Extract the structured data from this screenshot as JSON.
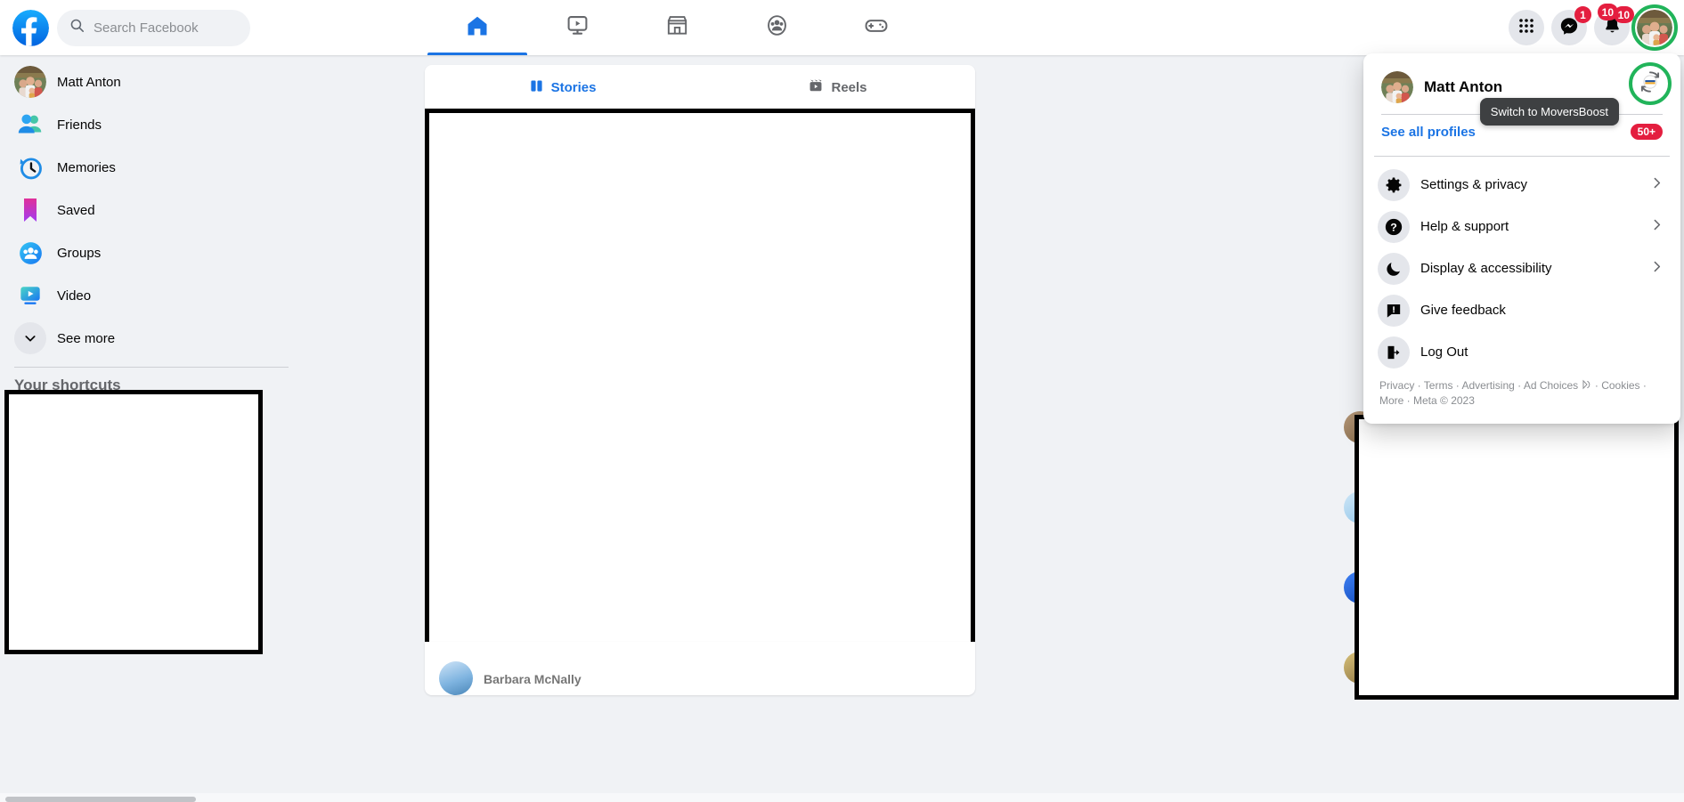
{
  "app": {
    "name": "Facebook"
  },
  "topbar": {
    "logo_icon": "facebook-logo-icon",
    "search": {
      "placeholder": "Search Facebook",
      "value": "",
      "icon": "search-icon"
    },
    "nav_tabs": [
      {
        "name": "home",
        "icon": "home-icon",
        "active": true,
        "label": "Home"
      },
      {
        "name": "video",
        "icon": "video-icon",
        "active": false,
        "label": "Video"
      },
      {
        "name": "marketplace",
        "icon": "marketplace-icon",
        "active": false,
        "label": "Marketplace"
      },
      {
        "name": "groups",
        "icon": "groups-icon",
        "active": false,
        "label": "Groups"
      },
      {
        "name": "gaming",
        "icon": "gaming-icon",
        "active": false,
        "label": "Gaming"
      }
    ],
    "right_actions": [
      {
        "name": "menu-grid",
        "icon": "grid-menu-icon",
        "badge": ""
      },
      {
        "name": "messenger",
        "icon": "messenger-icon",
        "badge": "1"
      },
      {
        "name": "notifications",
        "icon": "bell-icon",
        "badge": "10"
      },
      {
        "name": "account",
        "icon": "avatar-icon",
        "badge": "",
        "highlighted": true
      }
    ]
  },
  "sidebar": {
    "items": [
      {
        "label": "Matt Anton",
        "icon": "profile-avatar-icon"
      },
      {
        "label": "Friends",
        "icon": "friends-icon"
      },
      {
        "label": "Memories",
        "icon": "memories-clock-icon"
      },
      {
        "label": "Saved",
        "icon": "saved-bookmark-icon"
      },
      {
        "label": "Groups",
        "icon": "groups-circle-icon"
      },
      {
        "label": "Video",
        "icon": "video-play-icon"
      },
      {
        "label": "See more",
        "icon": "chevron-down-icon"
      }
    ],
    "shortcuts_title": "Your shortcuts"
  },
  "feed": {
    "tabs": [
      {
        "label": "Stories",
        "icon": "stories-icon",
        "active": true
      },
      {
        "label": "Reels",
        "icon": "reels-icon",
        "active": false
      }
    ],
    "peek_post_author": "Barbara McNally"
  },
  "account_menu": {
    "profile": {
      "name": "Matt Anton",
      "avatar_icon": "profile-avatar-icon",
      "switch_icon": "switch-profile-icon",
      "switch_highlighted": true
    },
    "see_all_profiles": "See all profiles",
    "profiles_count_badge": "50+",
    "tooltip": "Switch to MoversBoost",
    "items": [
      {
        "label": "Settings & privacy",
        "icon": "gear-icon",
        "chevron": true
      },
      {
        "label": "Help & support",
        "icon": "question-mark-icon",
        "chevron": true
      },
      {
        "label": "Display & accessibility",
        "icon": "moon-icon",
        "chevron": true
      },
      {
        "label": "Give feedback",
        "icon": "feedback-icon",
        "chevron": false
      },
      {
        "label": "Log Out",
        "icon": "logout-icon",
        "chevron": false
      }
    ],
    "footer_line1": "Privacy · Terms · Advertising · Ad Choices",
    "footer_adchoices_icon": "ad-choices-icon",
    "footer_line1_end": "· Cookies ·",
    "footer_line2": "More · Meta © 2023"
  },
  "colors": {
    "brand_blue": "#1b74e4",
    "badge_red": "#e41e3f",
    "highlight_green": "#21b45a",
    "page_bg": "#f0f2f5",
    "card_bg": "#ffffff",
    "text_secondary": "#65676b",
    "tooltip_bg": "#3e4042"
  }
}
